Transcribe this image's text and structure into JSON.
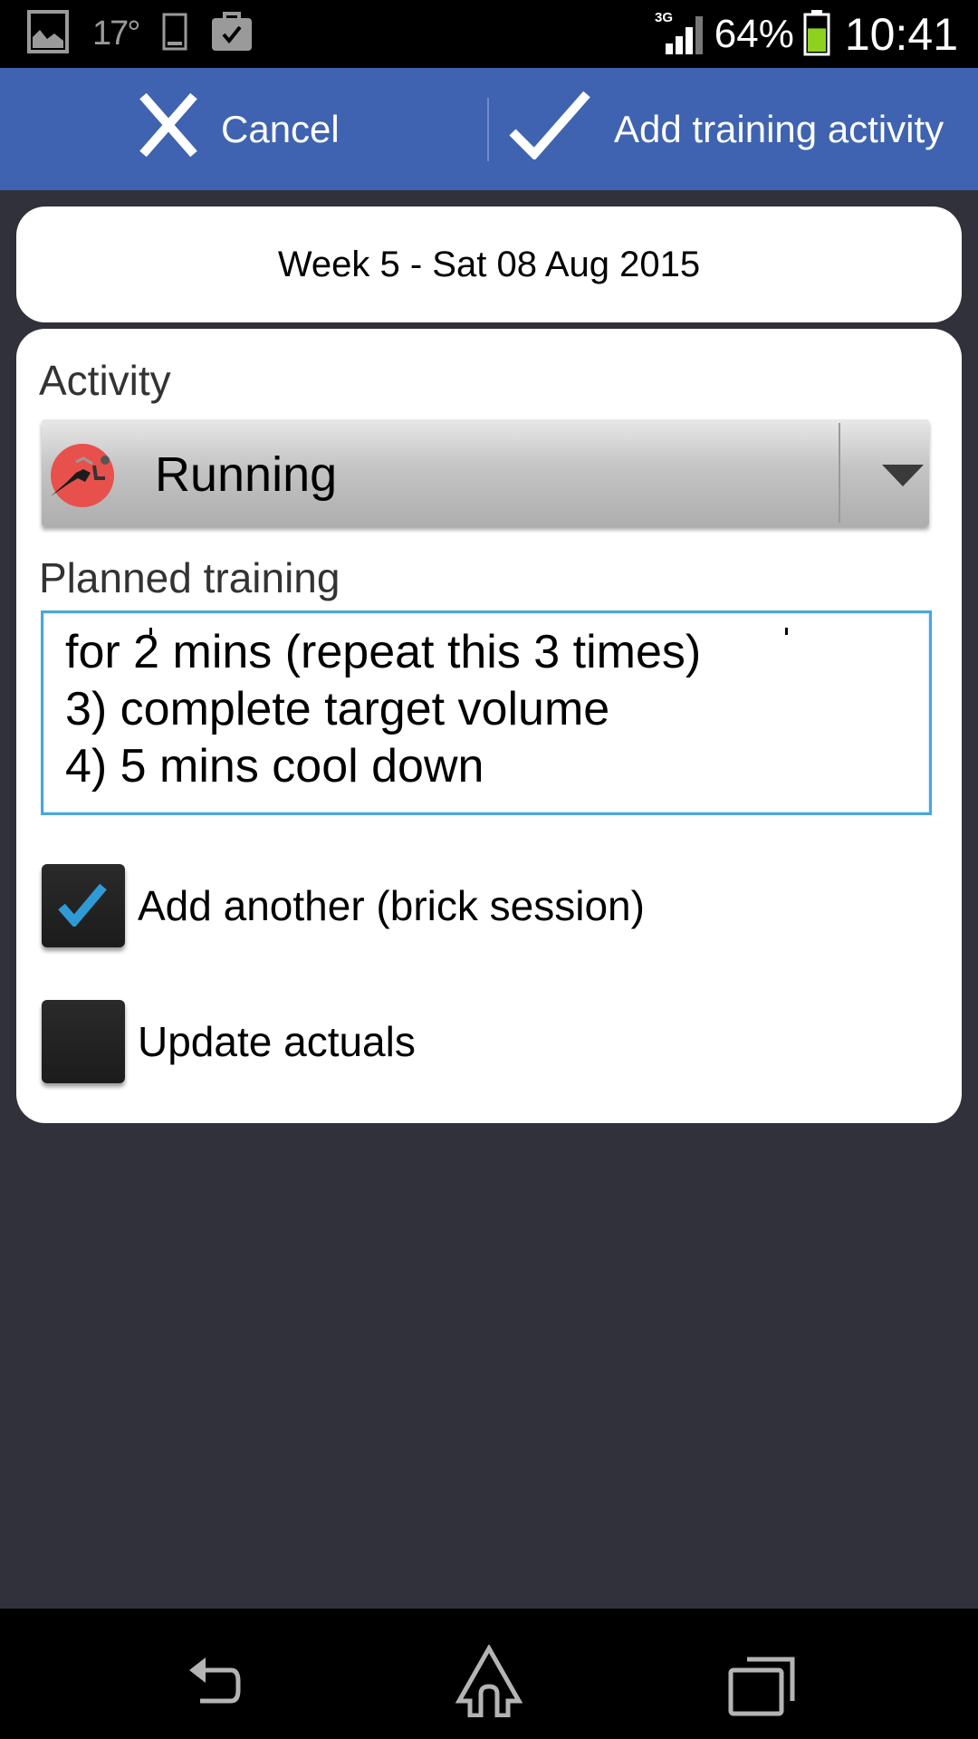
{
  "status_bar": {
    "left_icons": [
      "gallery-icon",
      "weather-temp",
      "phone-icon",
      "briefcase-check-icon"
    ],
    "temperature": "17°",
    "network": "3G",
    "battery_percent_text": "64%",
    "battery_level": 0.64,
    "time": "10:41"
  },
  "action_bar": {
    "cancel_label": "Cancel",
    "confirm_label": "Add training activity",
    "bar_color": "#3f63b0"
  },
  "date_header": {
    "text": "Week 5 - Sat 08 Aug 2015"
  },
  "form": {
    "activity_label": "Activity",
    "activity_value": "Running",
    "activity_icon": "runner-icon",
    "planned_label": "Planned training",
    "planned_text_visible": "for 2 mins (repeat this 3 times)\n3) complete target volume\n4) 5 mins cool down",
    "checkboxes": [
      {
        "label": "Add another (brick session)",
        "checked": true
      },
      {
        "label": "Update actuals",
        "checked": false
      }
    ],
    "focus_color": "#4aa6dc",
    "check_color": "#2f9ad6"
  },
  "nav_bar": {
    "buttons": [
      "back",
      "home",
      "recent-apps"
    ]
  }
}
